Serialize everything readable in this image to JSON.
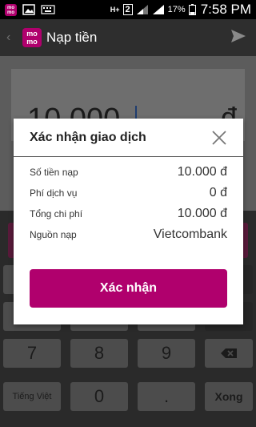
{
  "status_bar": {
    "network": "H+",
    "sim_slot": "2",
    "battery": "17%",
    "time": "7:58 PM"
  },
  "app_bar": {
    "logo_text": "mo\nmo",
    "title": "Nạp tiền"
  },
  "amount": {
    "value": "10.000",
    "currency": "đ"
  },
  "dialog": {
    "title": "Xác nhận giao dịch",
    "rows": [
      {
        "label": "Số tiền nạp",
        "value": "10.000 đ"
      },
      {
        "label": "Phí dịch vụ",
        "value": "0 đ"
      },
      {
        "label": "Tổng chi phí",
        "value": "10.000 đ"
      },
      {
        "label": "Nguồn nạp",
        "value": "Vietcombank"
      }
    ],
    "confirm_label": "Xác nhận"
  },
  "keyboard": {
    "row_middle": [
      "",
      "",
      "",
      ","
    ],
    "row_lower": [
      "7",
      "8",
      "9"
    ],
    "language": "Tiếng Việt",
    "zero": "0",
    "dot": ".",
    "done": "Xong"
  }
}
